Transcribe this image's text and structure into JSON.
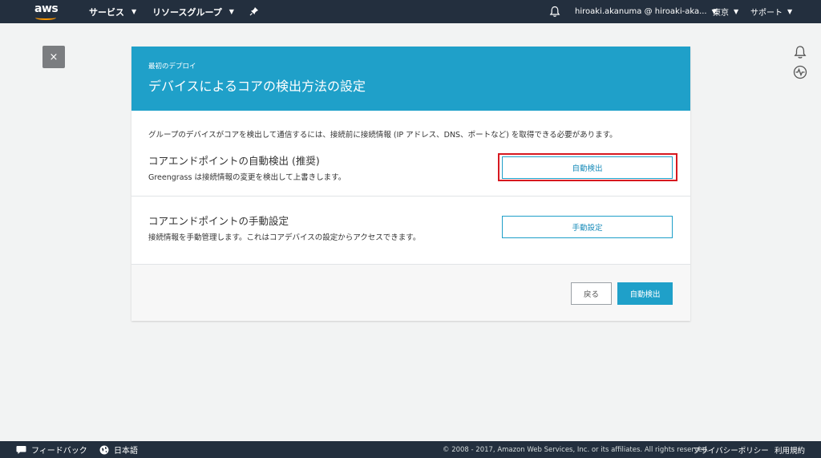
{
  "topnav": {
    "brand": "aws",
    "services": "サービス",
    "resource_groups": "リソースグループ",
    "account": "hiroaki.akanuma @ hiroaki-aka...",
    "region": "東京",
    "support": "サポート"
  },
  "card": {
    "breadcrumb": "最初のデプロイ",
    "title": "デバイスによるコアの検出方法の設定",
    "intro": "グループのデバイスがコアを検出して通信するには、接続前に接続情報 (IP アドレス、DNS、ポートなど) を取得できる必要があります。",
    "auto": {
      "title": "コアエンドポイントの自動検出 (推奨)",
      "desc": "Greengrass は接続情報の変更を検出して上書きします。",
      "button": "自動検出"
    },
    "manual": {
      "title": "コアエンドポイントの手動設定",
      "desc": "接続情報を手動管理します。これはコアデバイスの設定からアクセスできます。",
      "button": "手動設定"
    },
    "back_button": "戻る",
    "primary_button": "自動検出"
  },
  "close_label": "×",
  "footer": {
    "feedback": "フィードバック",
    "language": "日本語",
    "copyright": "© 2008 - 2017, Amazon Web Services, Inc. or its affiliates. All rights reserved.",
    "privacy": "プライバシーポリシー",
    "terms": "利用規約"
  },
  "colors": {
    "nav_bg": "#232f3e",
    "accent": "#1fa0c9",
    "highlight": "#d71920",
    "brand_smile": "#ff9900"
  }
}
